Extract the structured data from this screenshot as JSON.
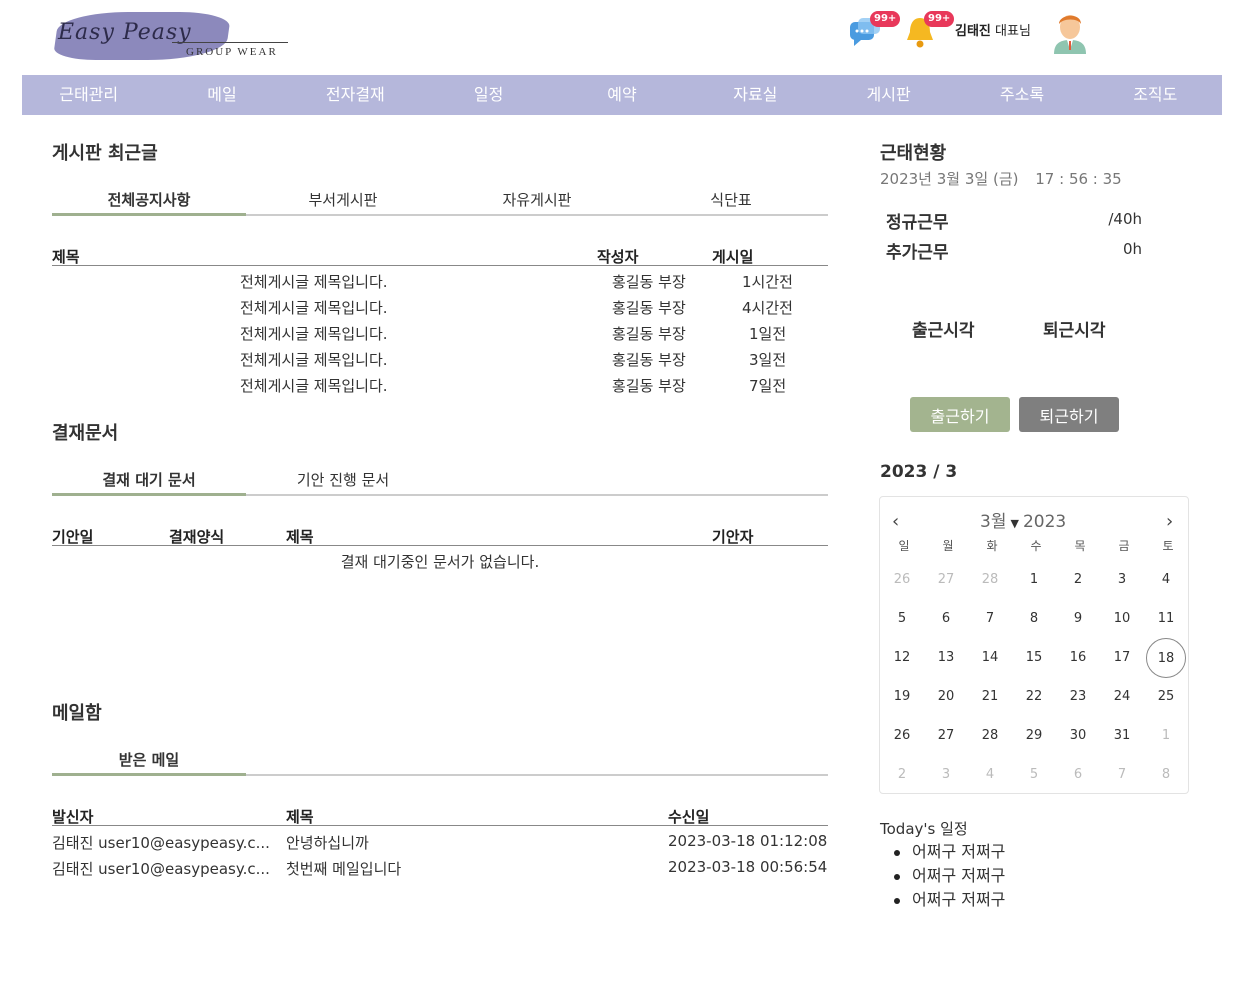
{
  "brand": {
    "script": "Easy Peasy",
    "sub": "GROUP WEAR"
  },
  "header": {
    "chat_badge": "99+",
    "bell_badge": "99+",
    "user_name": "김태진",
    "user_title": "대표님"
  },
  "nav": [
    "근태관리",
    "메일",
    "전자결재",
    "일정",
    "예약",
    "자료실",
    "게시판",
    "주소록",
    "조직도"
  ],
  "board": {
    "title": "게시판 최근글",
    "tabs": [
      "전체공지사항",
      "부서게시판",
      "자유게시판",
      "식단표"
    ],
    "columns": {
      "title": "제목",
      "author": "작성자",
      "date": "게시일"
    },
    "rows": [
      {
        "title": "전체게시글 제목입니다.",
        "author": "홍길동 부장",
        "date": "1시간전"
      },
      {
        "title": "전체게시글 제목입니다.",
        "author": "홍길동 부장",
        "date": "4시간전"
      },
      {
        "title": "전체게시글 제목입니다.",
        "author": "홍길동 부장",
        "date": "1일전"
      },
      {
        "title": "전체게시글 제목입니다.",
        "author": "홍길동 부장",
        "date": "3일전"
      },
      {
        "title": "전체게시글 제목입니다.",
        "author": "홍길동 부장",
        "date": "7일전"
      }
    ]
  },
  "approval": {
    "title": "결재문서",
    "tabs": [
      "결재 대기 문서",
      "기안 진행 문서"
    ],
    "columns": {
      "date": "기안일",
      "form": "결재양식",
      "title": "제목",
      "drafter": "기안자"
    },
    "empty": "결재 대기중인 문서가 없습니다."
  },
  "mail": {
    "title": "메일함",
    "tabs": [
      "받은 메일"
    ],
    "columns": {
      "sender": "발신자",
      "subject": "제목",
      "received": "수신일"
    },
    "rows": [
      {
        "sender": "김태진 user10@easypeasy.c...",
        "subject": "안녕하십니까",
        "received": "2023-03-18 01:12:08"
      },
      {
        "sender": "김태진 user10@easypeasy.c...",
        "subject": "첫번째 메일입니다",
        "received": "2023-03-18 00:56:54"
      }
    ]
  },
  "attendance": {
    "title": "근태현황",
    "date": "2023년 3월 3일 (금)",
    "time": "17 : 56 : 35",
    "regular_label": "정규근무",
    "regular_value": "/40h",
    "extra_label": "추가근무",
    "extra_value": "0h",
    "in_label": "출근시각",
    "out_label": "퇴근시각",
    "in_button": "출근하기",
    "out_button": "퇴근하기"
  },
  "calendar": {
    "title": "2023 / 3",
    "month": "3월",
    "year": "2023",
    "prev": "‹",
    "next": "›",
    "weekdays": [
      "일",
      "월",
      "화",
      "수",
      "목",
      "금",
      "토"
    ],
    "days": [
      [
        "26",
        "27",
        "28",
        "1",
        "2",
        "3",
        "4"
      ],
      [
        "5",
        "6",
        "7",
        "8",
        "9",
        "10",
        "11"
      ],
      [
        "12",
        "13",
        "14",
        "15",
        "16",
        "17",
        "18"
      ],
      [
        "19",
        "20",
        "21",
        "22",
        "23",
        "24",
        "25"
      ],
      [
        "26",
        "27",
        "28",
        "29",
        "30",
        "31",
        "1"
      ],
      [
        "2",
        "3",
        "4",
        "5",
        "6",
        "7",
        "8"
      ]
    ],
    "today": "18"
  },
  "today_schedule": {
    "title": "Today's 일정",
    "items": [
      "어쩌구 저쩌구",
      "어쩌구 저쩌구",
      "어쩌구 저쩌구"
    ]
  },
  "colors": {
    "nav": "#b5b7db",
    "tab_active": "#9fb08f",
    "in_button": "#a3b48f",
    "out_button": "#7f7f7f",
    "badge": "#e8385a"
  }
}
